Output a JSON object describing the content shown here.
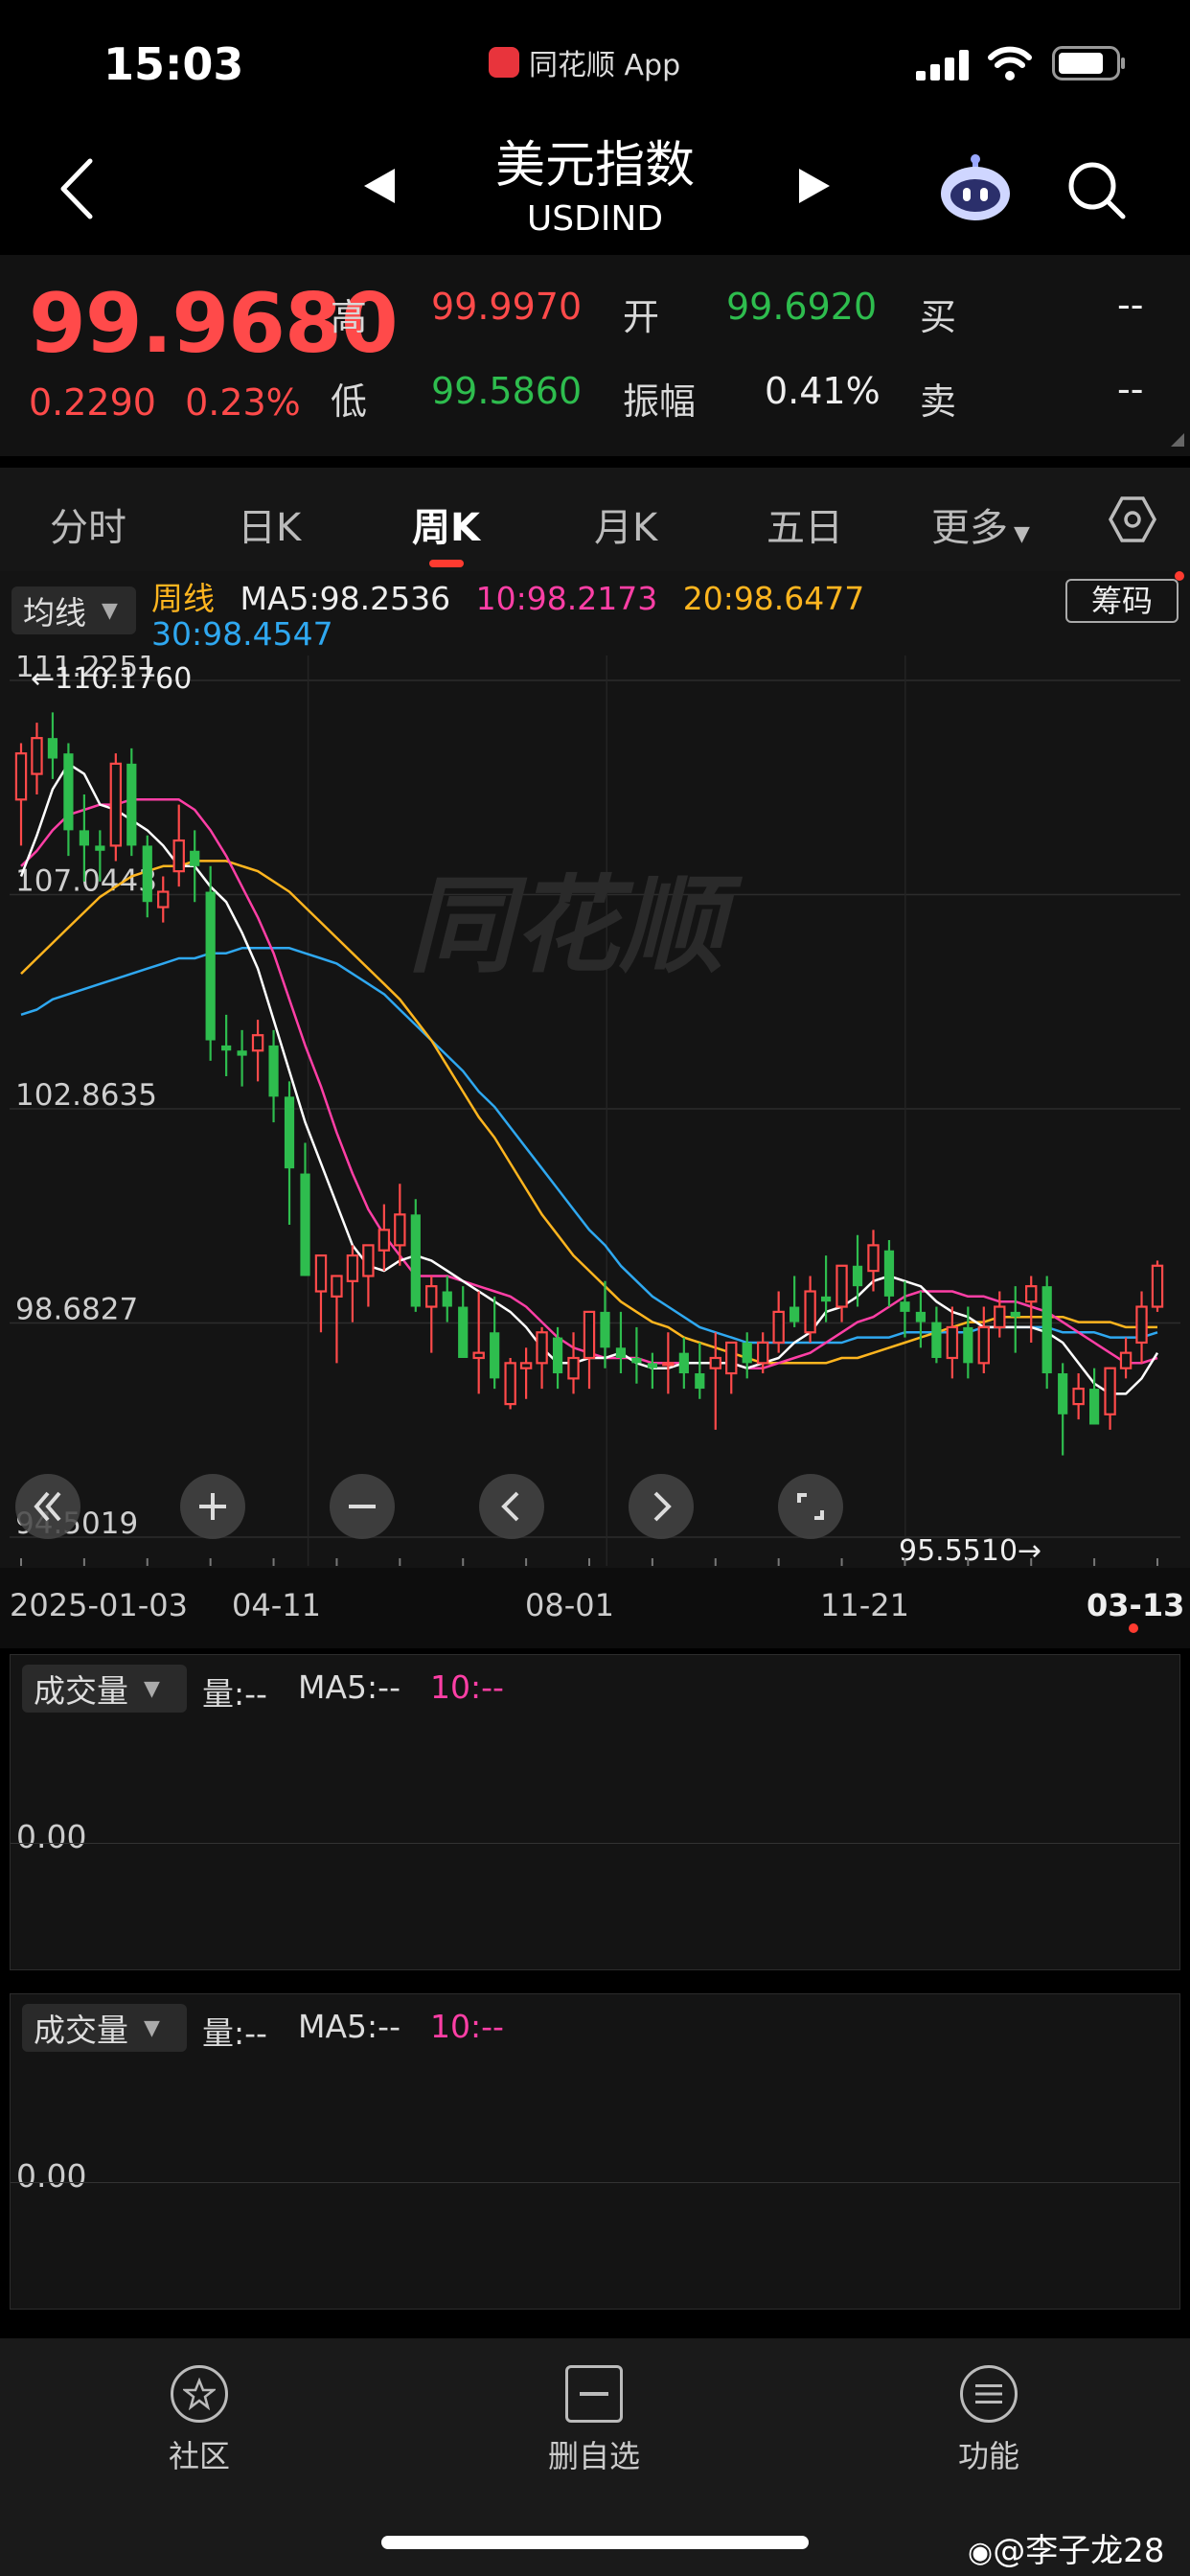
{
  "status": {
    "time": "15:03",
    "app_name": "同花顺 App"
  },
  "header": {
    "title": "美元指数",
    "code": "USDIND"
  },
  "quote": {
    "price": "99.9680",
    "change": "0.2290",
    "change_pct": "0.23%",
    "high_label": "高",
    "high": "99.9970",
    "low_label": "低",
    "low": "99.5860",
    "open_label": "开",
    "open": "99.6920",
    "amp_label": "振幅",
    "amp": "0.41%",
    "buy_label": "买",
    "buy": "--",
    "sell_label": "卖",
    "sell": "--"
  },
  "tabs": [
    "分时",
    "日K",
    "周K",
    "月K",
    "五日",
    "更多"
  ],
  "chart_legend": {
    "ma_select": "均线",
    "period": "周线",
    "ma5": "MA5:98.2536",
    "ma10": "10:98.2173",
    "ma20": "20:98.6477",
    "ma30": "30:98.4547",
    "chip_button": "筹码"
  },
  "colors": {
    "ma5": "#ffffff",
    "ma10": "#ff3fa6",
    "ma20": "#ffb51f",
    "ma30": "#2fa8f0",
    "up": "#ff4a4a",
    "down": "#2ebd4e"
  },
  "chart_data": {
    "type": "candlestick",
    "y_ticks": [
      "111.2251",
      "107.0443",
      "102.8635",
      "98.6827",
      "94.5019"
    ],
    "x_ticks": [
      "2025-01-03",
      "04-11",
      "08-01",
      "11-21",
      "03-13"
    ],
    "ylim": [
      94.5019,
      111.2251
    ],
    "max_label": "110.1760",
    "min_label": "95.5510",
    "candles": [
      [
        108.9,
        110.0,
        108.0,
        109.8
      ],
      [
        109.4,
        110.4,
        109.0,
        110.1
      ],
      [
        110.1,
        110.6,
        109.3,
        109.7
      ],
      [
        109.8,
        110.0,
        107.8,
        108.3
      ],
      [
        108.3,
        109.0,
        107.3,
        108.0
      ],
      [
        108.0,
        108.3,
        107.3,
        107.9
      ],
      [
        108.0,
        109.8,
        107.7,
        109.6
      ],
      [
        109.6,
        109.9,
        107.8,
        108.0
      ],
      [
        108.0,
        108.2,
        106.6,
        106.9
      ],
      [
        106.8,
        107.4,
        106.5,
        107.1
      ],
      [
        107.5,
        108.8,
        107.2,
        108.1
      ],
      [
        107.9,
        108.3,
        106.9,
        107.6
      ],
      [
        107.1,
        107.6,
        103.8,
        104.2
      ],
      [
        104.1,
        104.7,
        103.5,
        104.0
      ],
      [
        104.0,
        104.4,
        103.3,
        103.9
      ],
      [
        104.0,
        104.6,
        103.4,
        104.3
      ],
      [
        104.1,
        104.4,
        102.6,
        103.1
      ],
      [
        103.1,
        103.4,
        100.6,
        101.7
      ],
      [
        101.6,
        102.2,
        99.6,
        99.6
      ],
      [
        99.3,
        99.7,
        98.5,
        100.0
      ],
      [
        99.2,
        99.6,
        97.9,
        99.6
      ],
      [
        99.5,
        100.2,
        98.7,
        100.0
      ],
      [
        99.6,
        100.1,
        99.0,
        100.2
      ],
      [
        100.1,
        101.0,
        99.7,
        100.5
      ],
      [
        100.2,
        101.4,
        99.8,
        100.8
      ],
      [
        100.8,
        101.1,
        98.9,
        99.0
      ],
      [
        99.0,
        99.6,
        98.1,
        99.4
      ],
      [
        99.3,
        99.6,
        98.7,
        99.0
      ],
      [
        99.0,
        99.4,
        98.0,
        98.0
      ],
      [
        98.0,
        99.3,
        97.3,
        98.1
      ],
      [
        98.5,
        99.2,
        97.4,
        97.6
      ],
      [
        97.1,
        98.0,
        97.0,
        97.9
      ],
      [
        97.8,
        98.2,
        97.2,
        97.9
      ],
      [
        97.9,
        98.6,
        97.4,
        98.5
      ],
      [
        98.4,
        98.6,
        97.4,
        97.7
      ],
      [
        97.6,
        98.5,
        97.3,
        98.0
      ],
      [
        98.0,
        98.9,
        97.4,
        98.9
      ],
      [
        98.9,
        99.5,
        97.8,
        98.2
      ],
      [
        98.2,
        98.9,
        97.7,
        98.0
      ],
      [
        98.0,
        98.6,
        97.5,
        97.9
      ],
      [
        97.9,
        98.1,
        97.4,
        97.8
      ],
      [
        97.9,
        98.5,
        97.3,
        97.9
      ],
      [
        98.1,
        98.4,
        97.4,
        97.7
      ],
      [
        97.7,
        98.3,
        97.2,
        97.4
      ],
      [
        97.8,
        98.5,
        96.6,
        98.0
      ],
      [
        97.7,
        98.3,
        97.3,
        98.3
      ],
      [
        98.3,
        98.5,
        97.6,
        97.9
      ],
      [
        97.9,
        98.5,
        97.7,
        98.3
      ],
      [
        98.3,
        99.3,
        98.1,
        98.9
      ],
      [
        99.0,
        99.6,
        98.6,
        98.7
      ],
      [
        98.5,
        99.6,
        98.3,
        99.3
      ],
      [
        99.2,
        100.0,
        98.7,
        99.1
      ],
      [
        99.0,
        99.8,
        98.7,
        99.8
      ],
      [
        99.8,
        100.4,
        99.0,
        99.4
      ],
      [
        99.7,
        100.5,
        99.3,
        100.2
      ],
      [
        100.1,
        100.3,
        99.0,
        99.2
      ],
      [
        99.1,
        99.5,
        98.4,
        98.9
      ],
      [
        98.9,
        99.3,
        98.2,
        98.7
      ],
      [
        98.7,
        99.0,
        97.9,
        98.0
      ],
      [
        98.0,
        99.0,
        97.6,
        98.6
      ],
      [
        98.6,
        99.0,
        97.6,
        97.9
      ],
      [
        97.9,
        99.0,
        97.7,
        98.6
      ],
      [
        98.6,
        99.3,
        98.4,
        99.0
      ],
      [
        98.9,
        99.4,
        98.1,
        98.8
      ],
      [
        99.1,
        99.6,
        98.3,
        99.4
      ],
      [
        99.4,
        99.6,
        97.4,
        97.7
      ],
      [
        97.7,
        97.9,
        96.1,
        96.9
      ],
      [
        97.1,
        97.7,
        96.8,
        97.4
      ],
      [
        97.4,
        97.8,
        96.7,
        96.7
      ],
      [
        96.9,
        97.8,
        96.6,
        97.8
      ],
      [
        97.8,
        98.4,
        97.6,
        98.1
      ],
      [
        98.3,
        99.3,
        97.9,
        99.0
      ],
      [
        99.0,
        99.9,
        98.9,
        99.8
      ]
    ],
    "ma": {
      "ma5": [
        107.4,
        108.2,
        109.1,
        109.6,
        109.4,
        108.8,
        108.7,
        108.5,
        108.3,
        108.0,
        107.6,
        107.6,
        107.2,
        106.9,
        106.3,
        105.6,
        104.6,
        103.6,
        102.6,
        101.8,
        101.0,
        100.2,
        99.8,
        99.7,
        99.9,
        100.0,
        99.9,
        99.7,
        99.5,
        99.3,
        99.1,
        98.9,
        98.6,
        98.2,
        97.9,
        97.9,
        98.0,
        98.0,
        98.1,
        97.9,
        97.8,
        97.8,
        97.9,
        97.9,
        97.9,
        97.9,
        97.8,
        97.9,
        98.0,
        98.3,
        98.5,
        98.9,
        99.0,
        99.2,
        99.5,
        99.6,
        99.5,
        99.4,
        99.1,
        98.9,
        98.8,
        98.6,
        98.6,
        98.6,
        98.6,
        98.5,
        98.3,
        97.9,
        97.5,
        97.3,
        97.3,
        97.6,
        98.1
      ],
      "ma10": [
        107.6,
        107.9,
        108.3,
        108.6,
        108.7,
        108.8,
        108.8,
        108.9,
        108.9,
        108.9,
        108.9,
        108.7,
        108.3,
        107.8,
        107.2,
        106.6,
        105.9,
        105.0,
        104.1,
        103.3,
        102.4,
        101.6,
        100.9,
        100.4,
        100.0,
        99.6,
        99.6,
        99.6,
        99.5,
        99.4,
        99.3,
        99.2,
        99.0,
        98.7,
        98.4,
        98.2,
        98.1,
        98.0,
        98.0,
        98.0,
        97.9,
        97.9,
        97.9,
        97.9,
        97.9,
        97.9,
        97.8,
        97.8,
        97.9,
        98.0,
        98.1,
        98.3,
        98.5,
        98.7,
        98.8,
        99.0,
        99.2,
        99.3,
        99.3,
        99.3,
        99.2,
        99.2,
        99.1,
        99.1,
        99.0,
        98.9,
        98.7,
        98.5,
        98.3,
        98.1,
        97.9,
        97.9,
        98.0
      ],
      "ma20": [
        105.5,
        105.8,
        106.1,
        106.4,
        106.7,
        107.0,
        107.2,
        107.4,
        107.5,
        107.6,
        107.6,
        107.7,
        107.7,
        107.7,
        107.6,
        107.5,
        107.3,
        107.1,
        106.8,
        106.5,
        106.2,
        105.9,
        105.6,
        105.3,
        105.0,
        104.6,
        104.2,
        103.7,
        103.2,
        102.7,
        102.3,
        101.8,
        101.3,
        100.8,
        100.4,
        100.0,
        99.7,
        99.4,
        99.1,
        98.9,
        98.7,
        98.6,
        98.4,
        98.3,
        98.2,
        98.1,
        98.0,
        97.9,
        97.9,
        97.9,
        97.9,
        97.9,
        98.0,
        98.0,
        98.1,
        98.2,
        98.3,
        98.4,
        98.5,
        98.6,
        98.7,
        98.7,
        98.8,
        98.8,
        98.8,
        98.8,
        98.8,
        98.7,
        98.7,
        98.7,
        98.6,
        98.6,
        98.6
      ],
      "ma30": [
        104.7,
        104.8,
        105.0,
        105.1,
        105.2,
        105.3,
        105.4,
        105.5,
        105.6,
        105.7,
        105.8,
        105.8,
        105.9,
        105.9,
        106.0,
        106.0,
        106.0,
        106.0,
        105.9,
        105.8,
        105.7,
        105.5,
        105.3,
        105.1,
        104.8,
        104.5,
        104.2,
        103.9,
        103.6,
        103.2,
        102.9,
        102.5,
        102.1,
        101.7,
        101.3,
        100.9,
        100.5,
        100.2,
        99.8,
        99.5,
        99.2,
        99.0,
        98.8,
        98.6,
        98.5,
        98.4,
        98.3,
        98.3,
        98.3,
        98.3,
        98.3,
        98.3,
        98.3,
        98.4,
        98.4,
        98.4,
        98.5,
        98.5,
        98.5,
        98.5,
        98.5,
        98.6,
        98.6,
        98.6,
        98.6,
        98.6,
        98.5,
        98.5,
        98.5,
        98.4,
        98.4,
        98.4,
        98.5
      ]
    }
  },
  "volume_panels": [
    {
      "select": "成交量",
      "vol": "量:--",
      "ma5": "MA5:--",
      "ma10": "10:--",
      "zero": "0.00"
    },
    {
      "select": "成交量",
      "vol": "量:--",
      "ma5": "MA5:--",
      "ma10": "10:--",
      "zero": "0.00"
    }
  ],
  "bottom_nav": [
    {
      "label": "社区",
      "icon": "community-icon"
    },
    {
      "label": "删自选",
      "icon": "remove-watchlist-icon"
    },
    {
      "label": "功能",
      "icon": "menu-icon"
    }
  ],
  "watermark": "@李子龙28",
  "chart_watermark": "同花顺"
}
